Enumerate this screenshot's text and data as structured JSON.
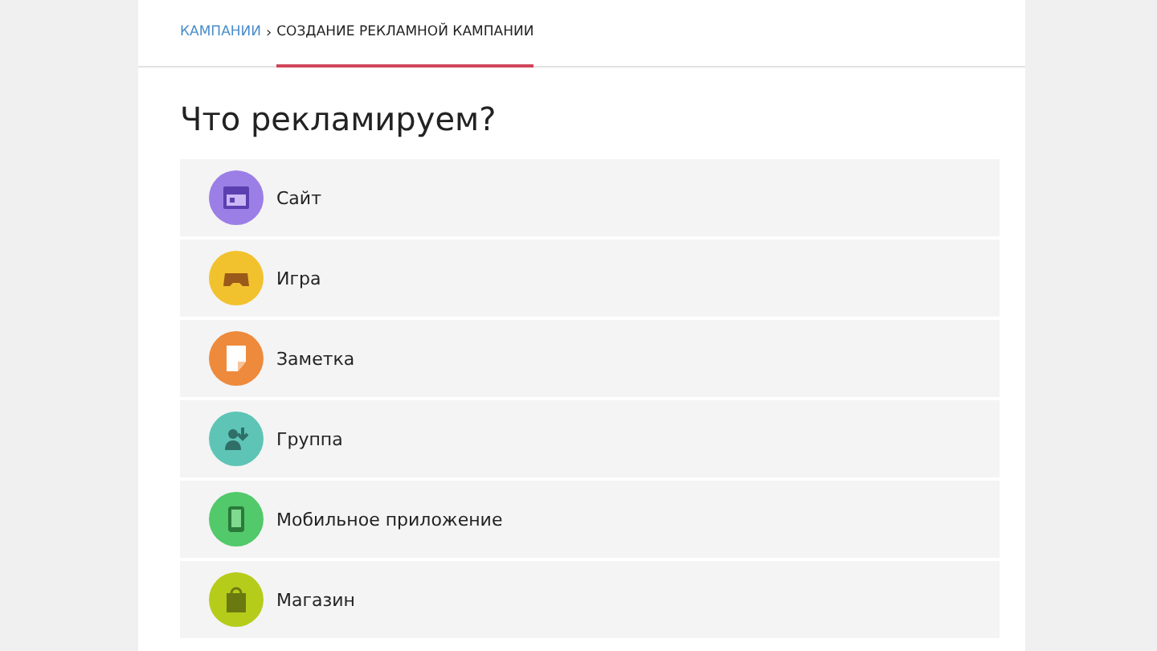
{
  "breadcrumb": {
    "separator": "›",
    "items": [
      {
        "label": "КАМПАНИИ",
        "selected": false
      },
      {
        "label": "СОЗДАНИЕ РЕКЛАМНОЙ КАМПАНИИ",
        "selected": true
      }
    ]
  },
  "title": "Что рекламируем?",
  "options": [
    {
      "label": "Сайт",
      "kind": "site",
      "color": "#9b7fe6"
    },
    {
      "label": "Игра",
      "kind": "game",
      "color": "#f2c22e"
    },
    {
      "label": "Заметка",
      "kind": "note",
      "color": "#ee8a3c"
    },
    {
      "label": "Группа",
      "kind": "group",
      "color": "#5ec4b6"
    },
    {
      "label": "Мобильное приложение",
      "kind": "mobile",
      "color": "#52c96a"
    },
    {
      "label": "Магазин",
      "kind": "shop",
      "color": "#b6cc1a"
    }
  ]
}
